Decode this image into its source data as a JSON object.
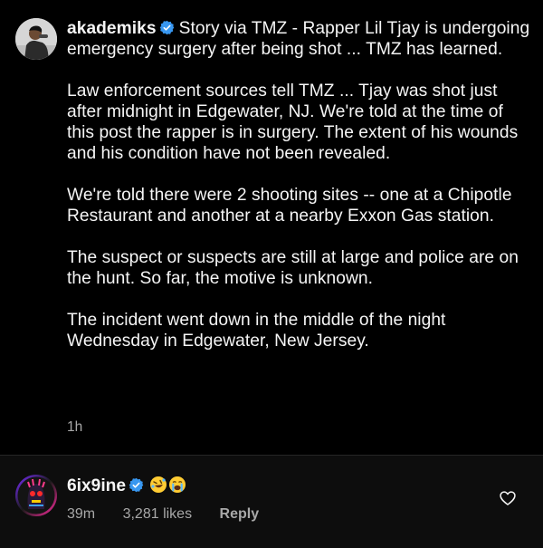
{
  "post": {
    "username": "akademiks",
    "icon": "verified-badge-icon",
    "paragraphs": [
      "Story via TMZ - Rapper Lil Tjay is undergoing emergency surgery after being shot ... TMZ has learned.",
      "Law enforcement sources tell TMZ ... Tjay was shot just after midnight in Edgewater, NJ. We're told at the time of this post the rapper is in surgery. The extent of his wounds and his condition have not been revealed.",
      "We're told there were 2 shooting sites -- one at a Chipotle Restaurant and another at a nearby Exxon Gas station.",
      "The suspect or suspects are still at large and police are on the hunt. So far, the motive is unknown.",
      "The incident went down in the middle of the night Wednesday in Edgewater, New Jersey."
    ],
    "time": "1h"
  },
  "comment": {
    "username": "6ix9ine",
    "emojis": [
      "rolling-on-floor-laughing-emoji",
      "loudly-crying-emoji"
    ],
    "time": "39m",
    "likes": "3,281 likes",
    "reply_label": "Reply",
    "like_icon": "heart-outline-icon"
  },
  "colors": {
    "background": "#000000",
    "comment_background": "#0d0d0d",
    "text": "#f5f5f5",
    "secondary_text": "#a8a8a8",
    "verified_blue": "#3897f0"
  }
}
